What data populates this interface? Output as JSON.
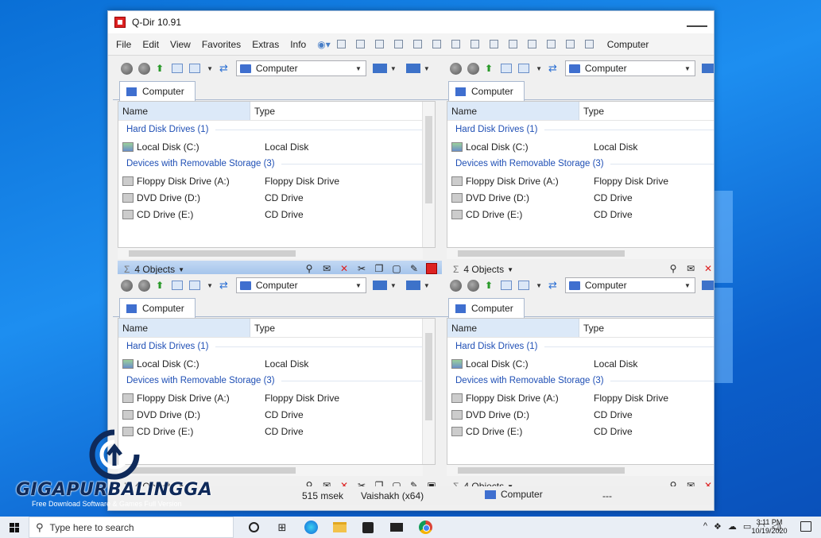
{
  "window": {
    "title": "Q-Dir 10.91"
  },
  "menu": {
    "items": [
      "File",
      "Edit",
      "View",
      "Favorites",
      "Extras",
      "Info"
    ],
    "right_label": "Computer"
  },
  "panes": [
    {
      "address": "Computer",
      "tab": "Computer",
      "columns": [
        "Name",
        "Type"
      ],
      "groups": [
        {
          "header": "Hard Disk Drives (1)",
          "rows": [
            {
              "name": "Local Disk (C:)",
              "type": "Local Disk"
            }
          ]
        },
        {
          "header": "Devices with Removable Storage (3)",
          "rows": [
            {
              "name": "Floppy Disk Drive (A:)",
              "type": "Floppy Disk Drive"
            },
            {
              "name": "DVD Drive (D:)",
              "type": "CD Drive"
            },
            {
              "name": "CD Drive (E:)",
              "type": "CD Drive"
            }
          ]
        }
      ],
      "status": "4 Objects"
    },
    {
      "address": "Computer",
      "tab": "Computer",
      "columns": [
        "Name",
        "Type"
      ],
      "groups": [
        {
          "header": "Hard Disk Drives (1)",
          "rows": [
            {
              "name": "Local Disk (C:)",
              "type": "Local Disk"
            }
          ]
        },
        {
          "header": "Devices with Removable Storage (3)",
          "rows": [
            {
              "name": "Floppy Disk Drive (A:)",
              "type": "Floppy Disk Drive"
            },
            {
              "name": "DVD Drive (D:)",
              "type": "CD Drive"
            },
            {
              "name": "CD Drive (E:)",
              "type": "CD Drive"
            }
          ]
        }
      ],
      "status": "4 Objects"
    },
    {
      "address": "Computer",
      "tab": "Computer",
      "columns": [
        "Name",
        "Type"
      ],
      "groups": [
        {
          "header": "Hard Disk Drives (1)",
          "rows": [
            {
              "name": "Local Disk (C:)",
              "type": "Local Disk"
            }
          ]
        },
        {
          "header": "Devices with Removable Storage (3)",
          "rows": [
            {
              "name": "Floppy Disk Drive (A:)",
              "type": "Floppy Disk Drive"
            },
            {
              "name": "DVD Drive (D:)",
              "type": "CD Drive"
            },
            {
              "name": "CD Drive (E:)",
              "type": "CD Drive"
            }
          ]
        }
      ],
      "status": "4 Objects"
    },
    {
      "address": "Computer",
      "tab": "Computer",
      "columns": [
        "Name",
        "Type"
      ],
      "groups": [
        {
          "header": "Hard Disk Drives (1)",
          "rows": [
            {
              "name": "Local Disk (C:)",
              "type": "Local Disk"
            }
          ]
        },
        {
          "header": "Devices with Removable Storage (3)",
          "rows": [
            {
              "name": "Floppy Disk Drive (A:)",
              "type": "Floppy Disk Drive"
            },
            {
              "name": "DVD Drive (D:)",
              "type": "CD Drive"
            },
            {
              "name": "CD Drive (E:)",
              "type": "CD Drive"
            }
          ]
        }
      ],
      "status": "4 Objects"
    }
  ],
  "bottom_status": {
    "time": "515 msek",
    "user": "Vaishakh (x64)",
    "location": "Computer",
    "extra": "---"
  },
  "watermark": {
    "brand": "GIGAPURBALINGGA",
    "tagline": "Free Download Software & Games Full Version"
  },
  "taskbar": {
    "search_placeholder": "Type here to search",
    "clock_time": "3:11 PM",
    "clock_date": "10/19/2020"
  },
  "colors": {
    "accent": "#3f6fcf",
    "group_header": "#1f4fb5",
    "close_red": "#dd2222"
  }
}
